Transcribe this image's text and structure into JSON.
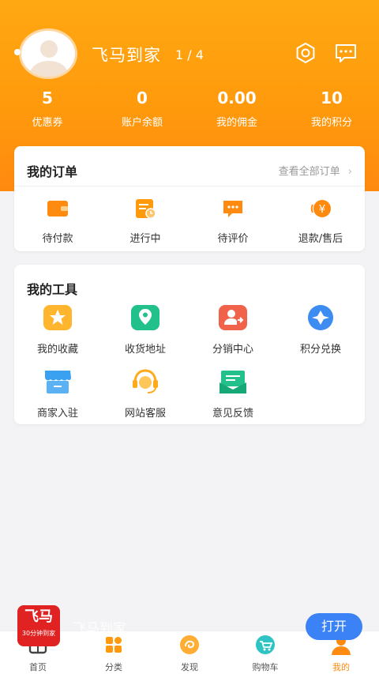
{
  "header": {
    "title": "飞马到家",
    "pager": "1 / 4"
  },
  "stats": [
    {
      "value": "5",
      "label": "优惠券"
    },
    {
      "value": "0",
      "label": "账户余额"
    },
    {
      "value": "0.00",
      "label": "我的佣金"
    },
    {
      "value": "10",
      "label": "我的积分"
    }
  ],
  "orders": {
    "title": "我的订单",
    "view_all": "查看全部订单",
    "items": [
      {
        "label": "待付款",
        "icon": "wallet-icon"
      },
      {
        "label": "进行中",
        "icon": "clock-list-icon"
      },
      {
        "label": "待评价",
        "icon": "comment-icon"
      },
      {
        "label": "退款/售后",
        "icon": "yen-refund-icon"
      }
    ]
  },
  "tools": {
    "title": "我的工具",
    "items": [
      {
        "label": "我的收藏",
        "icon": "star-icon"
      },
      {
        "label": "收货地址",
        "icon": "location-icon"
      },
      {
        "label": "分销中心",
        "icon": "distribution-icon"
      },
      {
        "label": "积分兑换",
        "icon": "diamond-icon"
      },
      {
        "label": "商家入驻",
        "icon": "shop-icon"
      },
      {
        "label": "网站客服",
        "icon": "headset-icon"
      },
      {
        "label": "意见反馈",
        "icon": "feedback-icon"
      }
    ]
  },
  "promo": {
    "logo_text": "飞马",
    "logo_sub": "30分钟到家",
    "name": "飞马到家",
    "open_label": "打开"
  },
  "tabs": [
    {
      "label": "首页",
      "icon": "home-icon"
    },
    {
      "label": "分类",
      "icon": "category-icon"
    },
    {
      "label": "发现",
      "icon": "discover-icon"
    },
    {
      "label": "购物车",
      "icon": "cart-icon"
    },
    {
      "label": "我的",
      "icon": "profile-icon",
      "active": true
    }
  ],
  "colors": {
    "accent": "#ff9a0c",
    "open_button": "#3b82f6",
    "brand_red": "#e02222"
  }
}
